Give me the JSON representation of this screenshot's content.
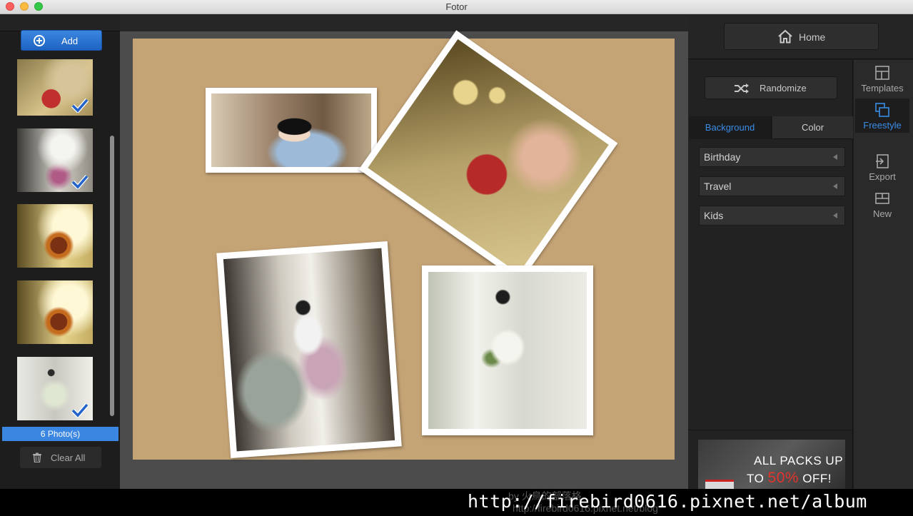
{
  "window": {
    "title": "Fotor"
  },
  "left_panel": {
    "add_label": "Add",
    "photo_count": "6 Photo(s)",
    "clear_label": "Clear All",
    "thumbnails": [
      {
        "subject": "rose-dancer",
        "selected": true
      },
      {
        "subject": "room-dancer",
        "selected": true
      },
      {
        "subject": "tulip",
        "selected": false
      },
      {
        "subject": "tulip",
        "selected": false
      },
      {
        "subject": "white-dress",
        "selected": true
      }
    ]
  },
  "right_panel": {
    "home_label": "Home",
    "randomize_label": "Randomize",
    "tabs": {
      "background": "Background",
      "color": "Color"
    },
    "categories": [
      "Birthday",
      "Travel",
      "Kids"
    ],
    "promo": {
      "line1": "ALL PACKS UP",
      "line2_prefix": "TO ",
      "line2_percent": "50%",
      "line2_suffix": " OFF!"
    }
  },
  "toolbar": {
    "templates": "Templates",
    "freestyle": "Freestyle",
    "export": "Export",
    "new": "New"
  },
  "watermark": {
    "main": "http://firebird0616.pixnet.net/album",
    "faint_1": "by 火鳥的部落格",
    "faint_2": "http://firebird0616.pixnet.net/blog"
  },
  "colors": {
    "accent": "#3a86e0",
    "canvas_bg": "#c4a375",
    "promo_red": "#e2342c"
  }
}
